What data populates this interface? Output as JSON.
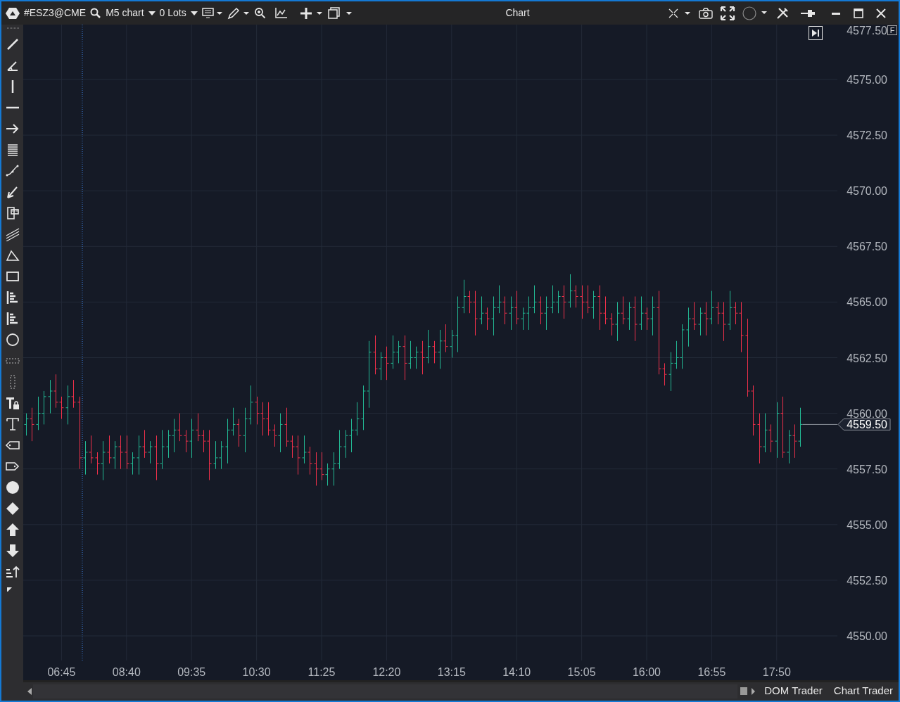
{
  "window": {
    "title": "Chart"
  },
  "toolbar": {
    "symbol": "#ESZ3@CME",
    "timeframe": "M5 chart",
    "lots": "0 Lots"
  },
  "chart": {
    "last_price": "4559.50",
    "corner_label": "F",
    "price_labels": [
      "4577.50",
      "4575.00",
      "4572.50",
      "4570.00",
      "4567.50",
      "4565.00",
      "4562.50",
      "4560.00",
      "4557.50",
      "4555.00",
      "4552.50",
      "4550.00"
    ],
    "time_labels": [
      "06:45",
      "08:40",
      "09:35",
      "10:30",
      "11:25",
      "12:20",
      "13:15",
      "14:10",
      "15:05",
      "16:00",
      "16:55",
      "17:50"
    ]
  },
  "bottom_tabs": [
    "DOM Trader",
    "Chart Trader"
  ]
}
